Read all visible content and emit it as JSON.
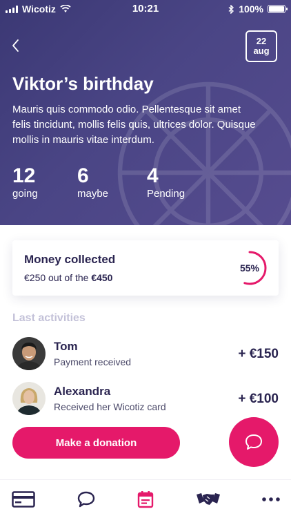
{
  "status_bar": {
    "carrier": "Wicotiz",
    "time": "10:21",
    "battery": "100%",
    "icons": [
      "signal-icon",
      "wifi-icon",
      "bluetooth-icon",
      "battery-icon"
    ]
  },
  "header": {
    "back_icon": "chevron-left-icon",
    "date_day": "22",
    "date_month": "aug",
    "title": "Viktor’s birthday",
    "description": "Mauris quis commodo odio. Pellentesque sit amet felis tincidunt, mollis felis quis, ultrices dolor. Quisque mollis in mauris vitae interdum.",
    "stats": [
      {
        "value": "12",
        "label": "going"
      },
      {
        "value": "6",
        "label": "maybe"
      },
      {
        "value": "4",
        "label": "Pending"
      }
    ]
  },
  "money": {
    "title": "Money collected",
    "sub_prefix": "€250 out of the ",
    "sub_total": "€450",
    "progress_label": "55%",
    "progress_fraction": 0.55
  },
  "activities": {
    "title": "Last activities",
    "items": [
      {
        "name": "Tom",
        "description": "Payment received",
        "amount": "+ €150"
      },
      {
        "name": "Alexandra",
        "description": "Received her Wicotiz card",
        "amount": "+ €100"
      }
    ]
  },
  "actions": {
    "donate_label": "Make a donation",
    "chat_icon": "chat-bubble-icon"
  },
  "tabbar": {
    "items": [
      "card-icon",
      "chat-icon",
      "calendar-icon",
      "handshake-icon",
      "more-icon"
    ],
    "active_index": 2
  },
  "colors": {
    "accent": "#e5196a",
    "hero": "#4a4585",
    "text_dark": "#2a2450",
    "muted": "#c3c1d8"
  }
}
